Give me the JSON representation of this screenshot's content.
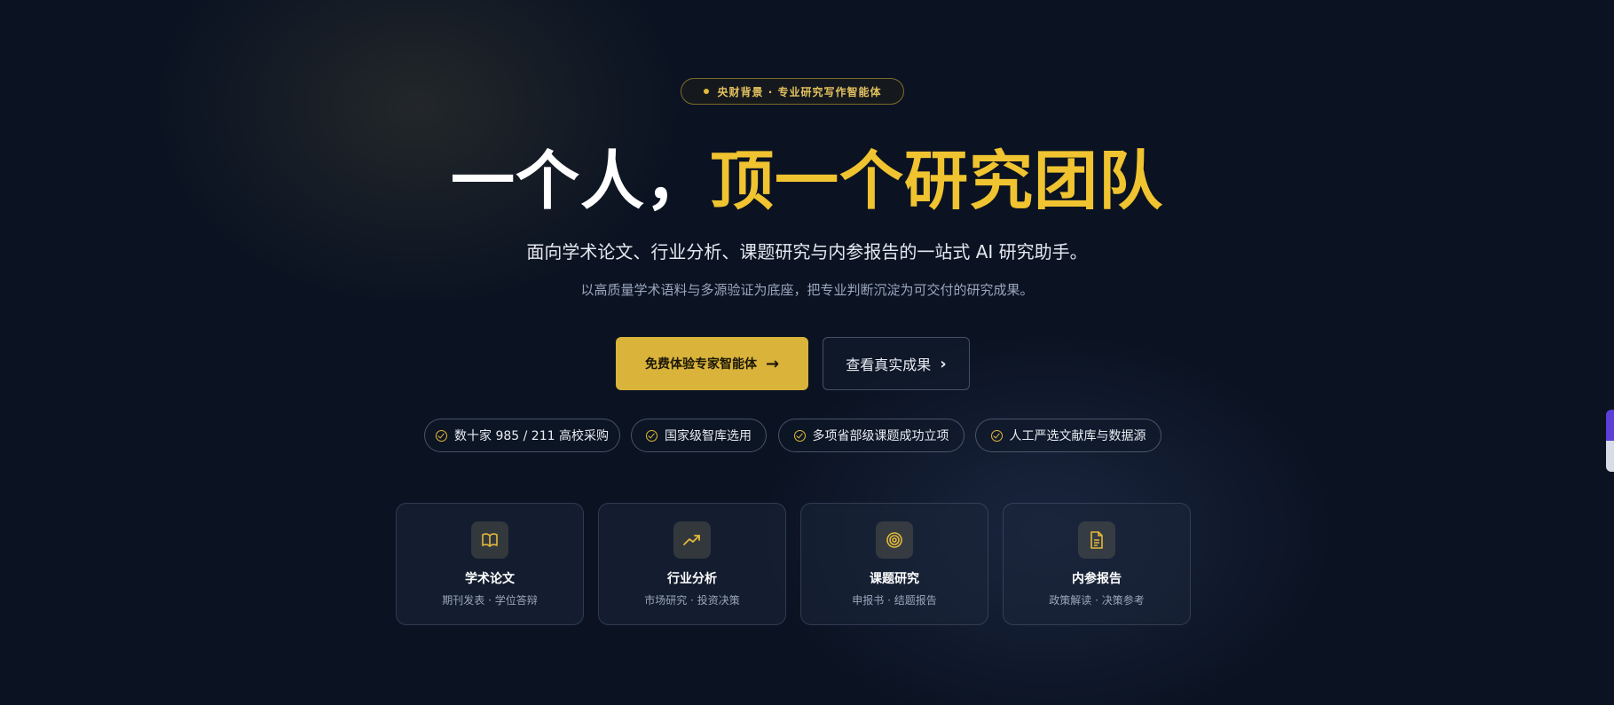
{
  "badge": {
    "text": "央财背景 · 专业研究写作智能体"
  },
  "hero": {
    "part1": "一个人，",
    "part2": "顶一个研究团队"
  },
  "subtitle": "面向学术论文、行业分析、课题研究与内参报告的一站式 AI 研究助手。",
  "tagline": "以高质量学术语料与多源验证为底座，把专业判断沉淀为可交付的研究成果。",
  "cta": {
    "primary": "免费体验专家智能体",
    "secondary": "查看真实成果"
  },
  "highlights": [
    "数十家 985 / 211 高校采购",
    "国家级智库选用",
    "多项省部级课题成功立项",
    "人工严选文献库与数据源"
  ],
  "cards": [
    {
      "title": "学术论文",
      "desc": "期刊发表 · 学位答辩",
      "icon": "book-icon"
    },
    {
      "title": "行业分析",
      "desc": "市场研究 · 投资决策",
      "icon": "trending-up-icon"
    },
    {
      "title": "课题研究",
      "desc": "申报书 · 结题报告",
      "icon": "target-icon"
    },
    {
      "title": "内参报告",
      "desc": "政策解读 · 决策参考",
      "icon": "document-icon"
    }
  ],
  "colors": {
    "accent": "#d9b33a",
    "background": "#0b1322"
  }
}
